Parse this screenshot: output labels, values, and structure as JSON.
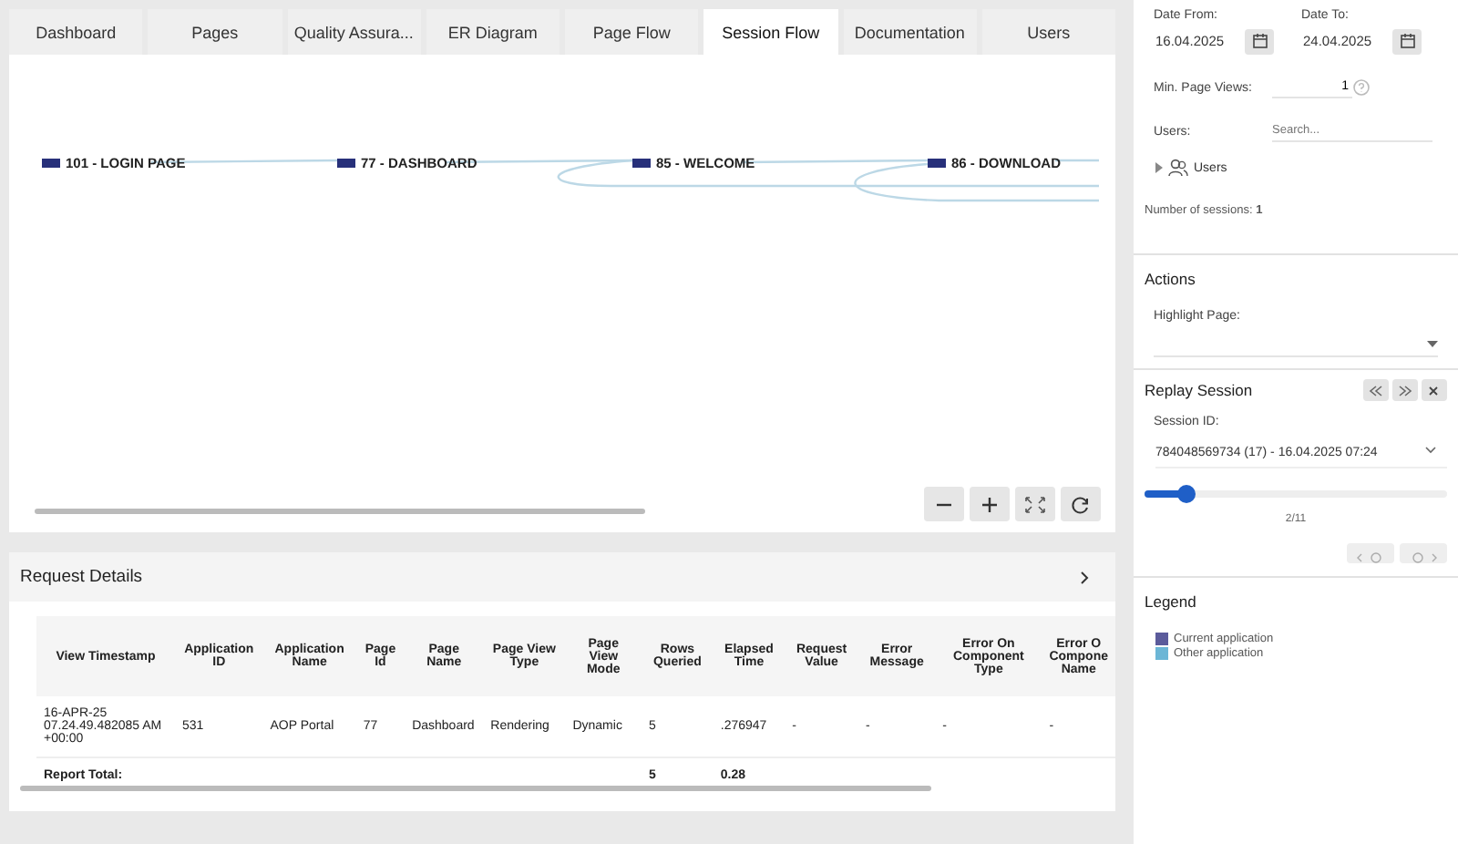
{
  "tabs": [
    {
      "label": "Dashboard",
      "selected": false
    },
    {
      "label": "Pages",
      "selected": false
    },
    {
      "label": "Quality Assura...",
      "selected": false
    },
    {
      "label": "ER Diagram",
      "selected": false
    },
    {
      "label": "Page Flow",
      "selected": false
    },
    {
      "label": "Session Flow",
      "selected": true
    },
    {
      "label": "Documentation",
      "selected": false
    },
    {
      "label": "Users",
      "selected": false
    }
  ],
  "flow": {
    "nodes": [
      {
        "label": "101 - LOGIN PAGE"
      },
      {
        "label": "77 - DASHBOARD"
      },
      {
        "label": "85 - WELCOME"
      },
      {
        "label": "86 - DOWNLOAD"
      }
    ]
  },
  "request_details": {
    "title": "Request Details",
    "columns": [
      "View Timestamp",
      "Application ID",
      "Application Name",
      "Page Id",
      "Page Name",
      "Page View Type",
      "Page View Mode",
      "Rows Queried",
      "Elapsed Time",
      "Request Value",
      "Error Message",
      "Error On Component Type",
      "Error O Compone Name"
    ],
    "rows": [
      [
        "16-APR-25 07.24.49.482085 AM +00:00",
        "531",
        "AOP Portal",
        "77",
        "Dashboard",
        "Rendering",
        "Dynamic",
        "5",
        ".276947",
        "-",
        "-",
        "-",
        "-"
      ]
    ],
    "total": {
      "label": "Report Total:",
      "rows_queried": "5",
      "elapsed_time": "0.28"
    }
  },
  "filters": {
    "date_from": {
      "label": "Date From:",
      "value": "16.04.2025"
    },
    "date_to": {
      "label": "Date To:",
      "value": "24.04.2025"
    },
    "min_page_views": {
      "label": "Min. Page Views:",
      "value": "1"
    },
    "users": {
      "label": "Users:",
      "placeholder": "Search..."
    },
    "users_tree": {
      "label": "Users",
      "expanded": false
    },
    "sessions_count": "Number of sessions: **1**"
  },
  "actions": {
    "title": "Actions",
    "highlight_label": "Highlight Page:"
  },
  "replay": {
    "title": "Replay Session",
    "session_label": "Session ID:",
    "session_value": "784048569734 (17) - 16.04.2025 07:24",
    "level": 0.14,
    "position": "2/11"
  },
  "legend": {
    "title": "Legend",
    "items": [
      {
        "label": "Current application",
        "color": "#5b5b9b"
      },
      {
        "label": "Other application",
        "color": "#6cb6d6"
      }
    ]
  }
}
